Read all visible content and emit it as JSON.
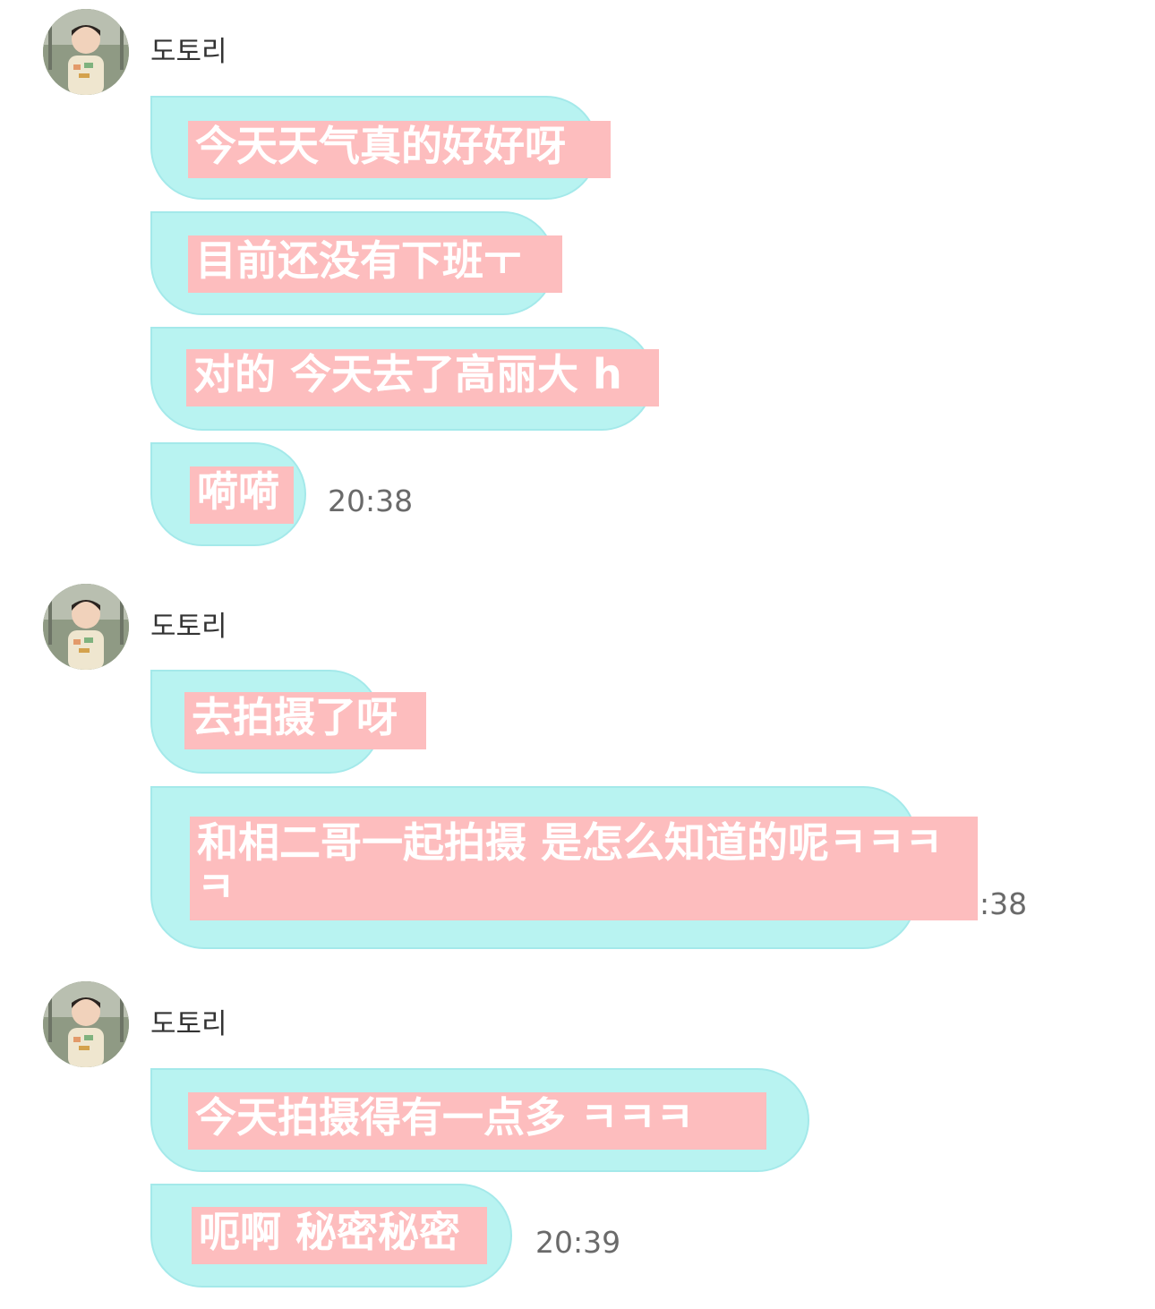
{
  "groups": [
    {
      "sender": "도토리",
      "messages": [
        {
          "text": "今天天气真的好好呀"
        },
        {
          "text": "目前还没有下班ㅜ"
        },
        {
          "text": "对的 今天去了高丽大 h"
        },
        {
          "text": "嗬嗬",
          "time": "20:38"
        }
      ]
    },
    {
      "sender": "도토리",
      "messages": [
        {
          "text": "去拍摄了呀"
        },
        {
          "text": "和相二哥一起拍摄 是怎么知道的呢ㅋㅋㅋㅋ",
          "time": ":38"
        }
      ]
    },
    {
      "sender": "도토리",
      "messages": [
        {
          "text": "今天拍摄得有一点多 ㅋㅋㅋ"
        },
        {
          "text": "呃啊 秘密秘密",
          "time": "20:39"
        }
      ]
    }
  ],
  "colors": {
    "bubble": "#b8f3f1",
    "bubble_border": "#a4e9ea",
    "text_highlight": "#fdbdbe",
    "text": "#ffffff",
    "timestamp": "#6a6a6a"
  },
  "icons": {
    "avatar": "profile-photo-child"
  }
}
